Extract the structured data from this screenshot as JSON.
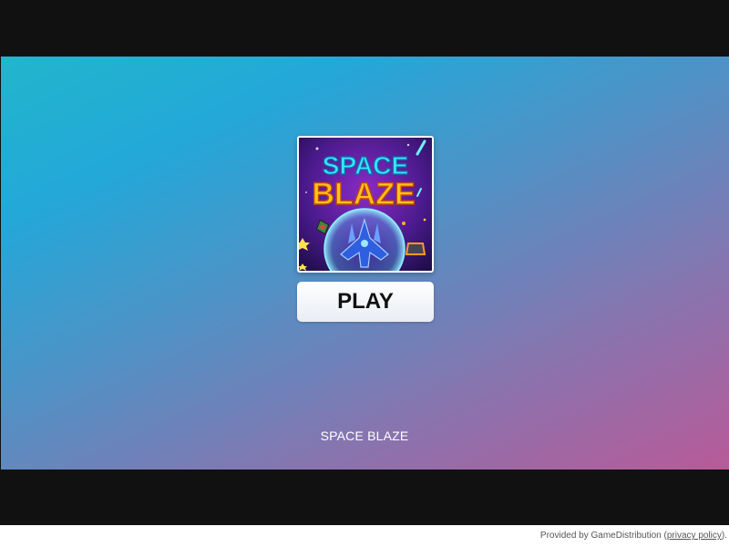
{
  "game": {
    "logo_line1": "SPACE",
    "logo_line2": "BLAZE",
    "play_label": "PLAY",
    "title": "SPACE BLAZE"
  },
  "footer": {
    "prefix": "Provided by GameDistribution (",
    "link_label": "privacy policy",
    "suffix": ")."
  },
  "colors": {
    "letterbox": "#111111",
    "gradient_start": "#22b6cc",
    "gradient_end": "#b85a98",
    "logo_space": "#38e6ff",
    "logo_blaze": "#ffc21a"
  },
  "icons": {
    "thumbnail": "spaceship-icon"
  }
}
